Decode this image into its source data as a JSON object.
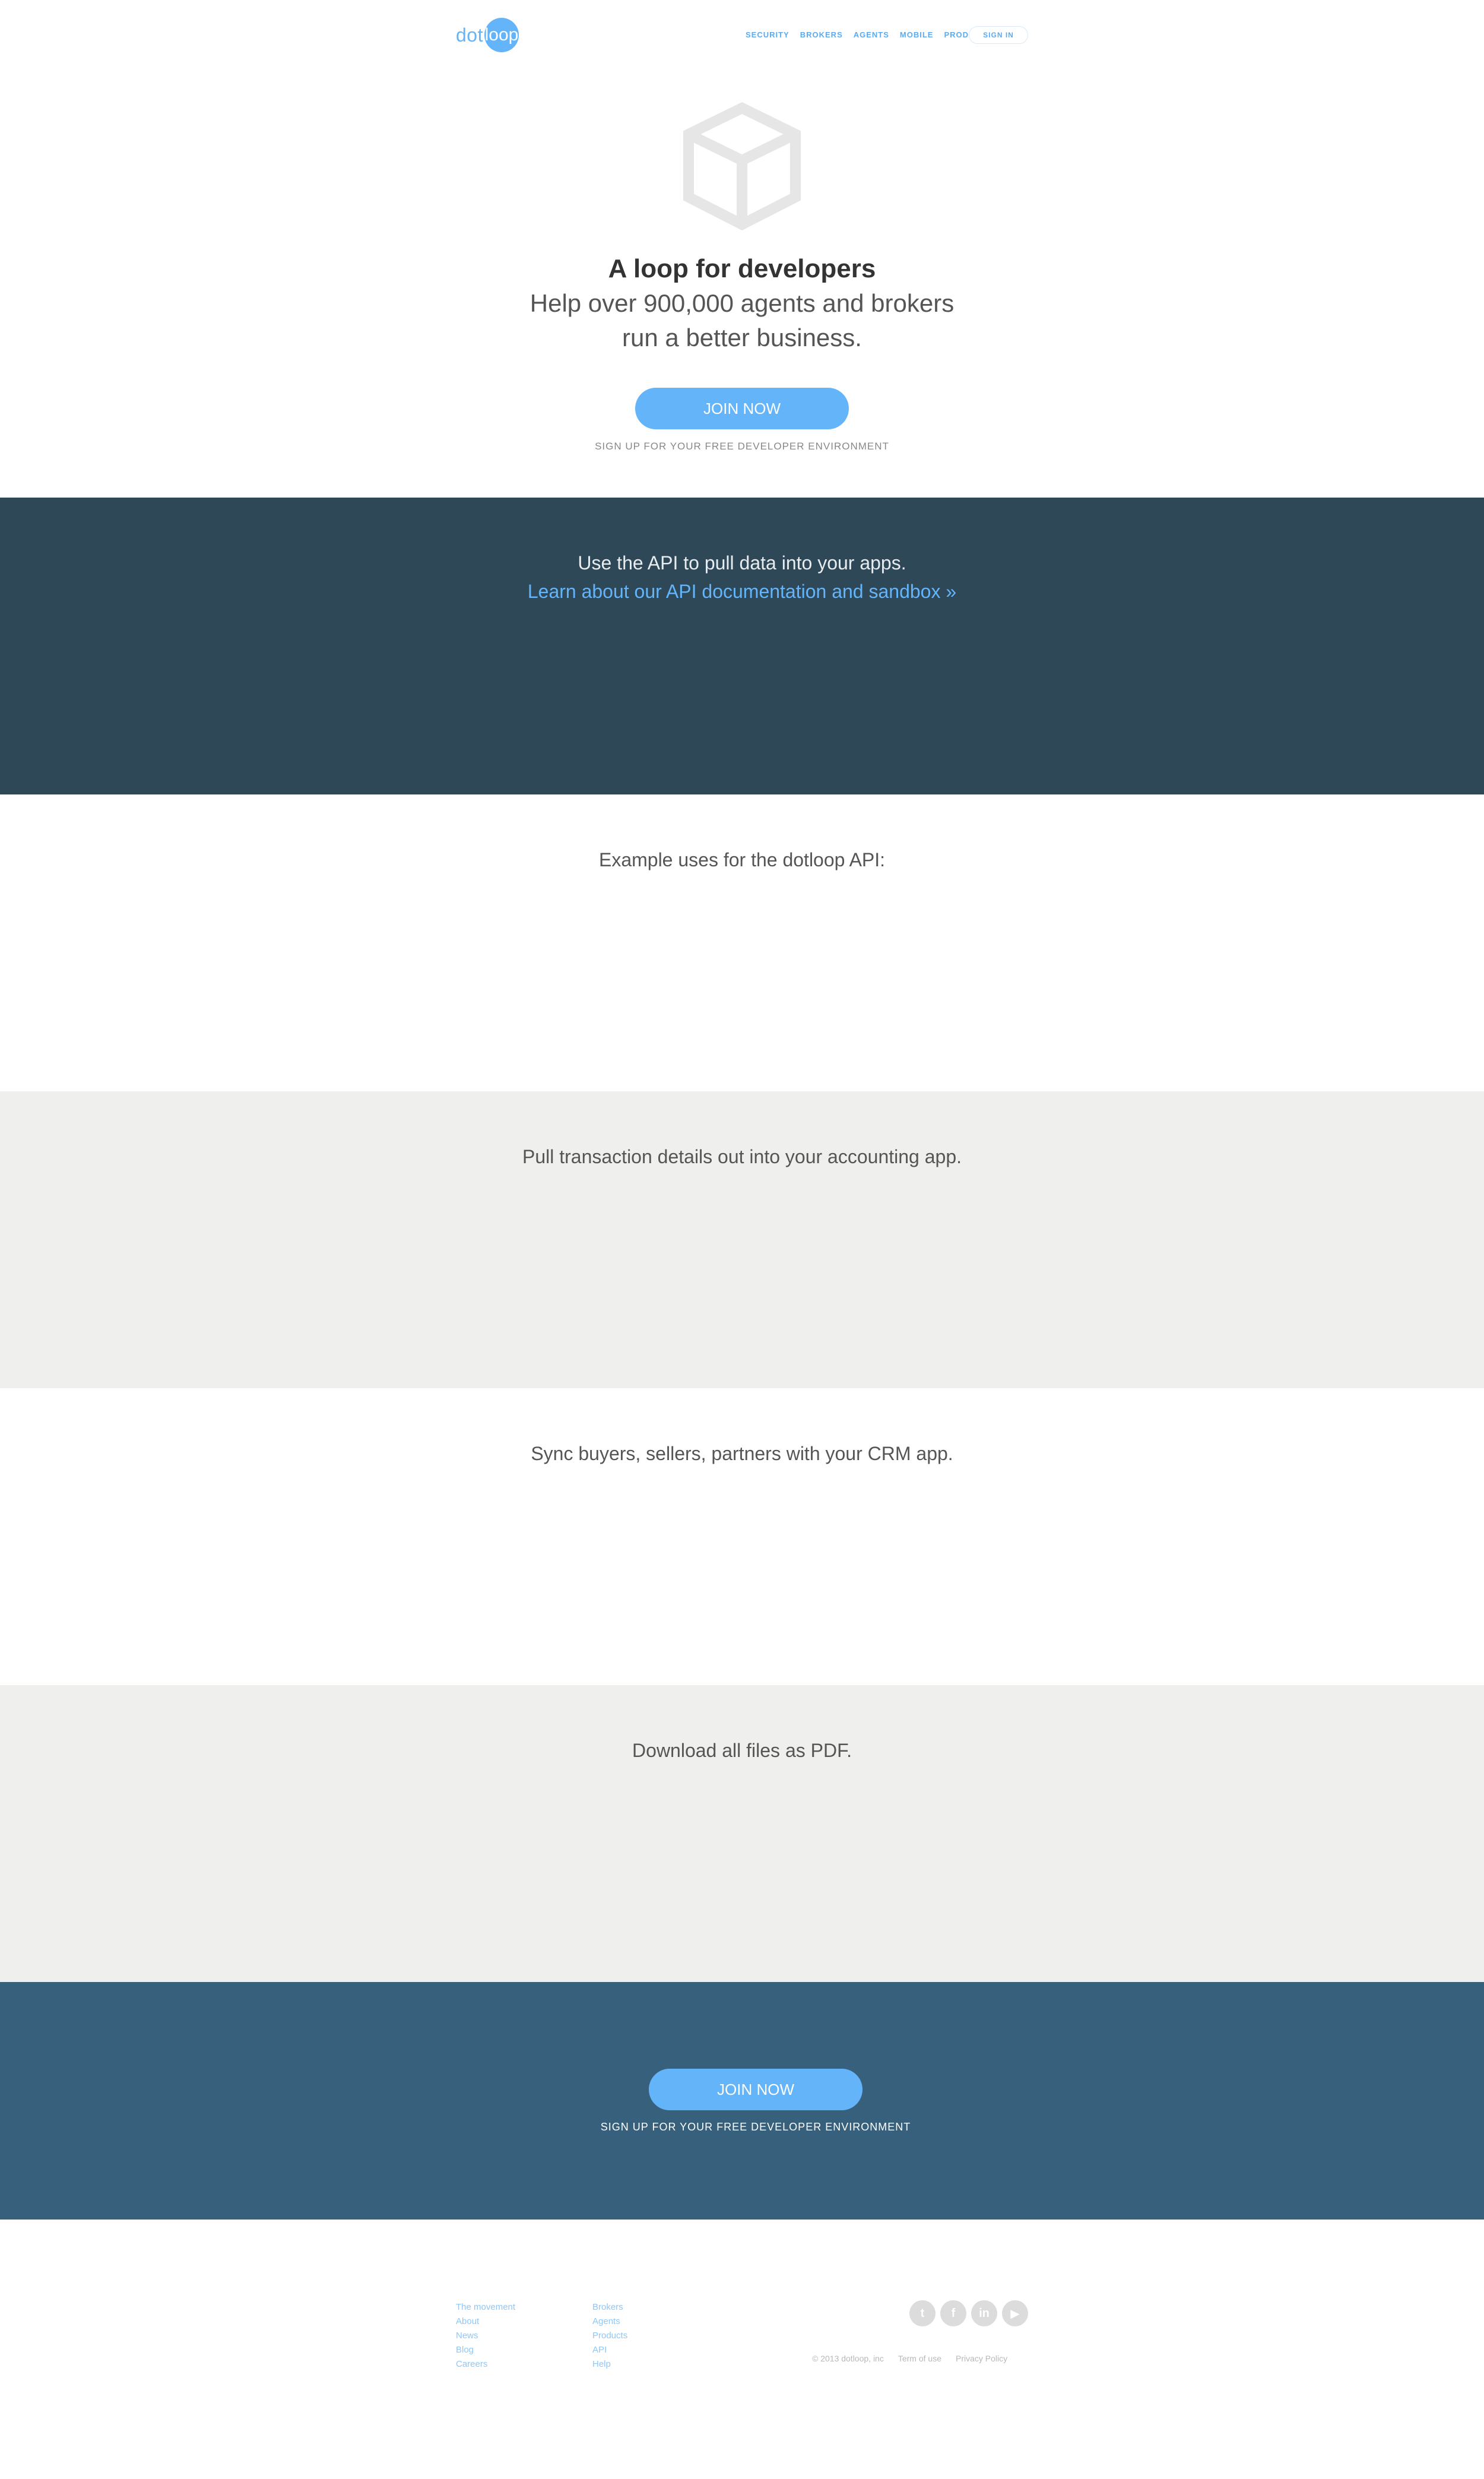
{
  "header": {
    "logo": {
      "dot": "dot",
      "loop": "loop"
    },
    "nav": [
      "SECURITY",
      "BROKERS",
      "AGENTS",
      "MOBILE",
      "PRODUCTS"
    ],
    "signin": "SIGN IN"
  },
  "hero": {
    "icon": "cube-icon",
    "title": "A loop for developers",
    "subtitle_line1": "Help over 900,000 agents and brokers",
    "subtitle_line2": "run a better business.",
    "button": "JOIN NOW",
    "note": "SIGN UP FOR YOUR FREE DEVELOPER ENVIRONMENT"
  },
  "api": {
    "line1": "Use the API to pull data into your apps.",
    "link": "Learn about our API documentation and sandbox »"
  },
  "examples": {
    "intro": "Example uses for the dotloop API:",
    "accounting": "Pull transaction details out into your accounting app.",
    "crm": "Sync buyers, sellers, partners with your CRM app.",
    "pdf": "Download all files as PDF."
  },
  "cta": {
    "button": "JOIN NOW",
    "note": "SIGN UP FOR YOUR FREE DEVELOPER ENVIRONMENT"
  },
  "footer": {
    "col1": [
      "The movement",
      "About",
      "News",
      "Blog",
      "Careers"
    ],
    "col2": [
      "Brokers",
      "Agents",
      "Products",
      "API",
      "Help"
    ],
    "social": [
      {
        "icon": "twitter-icon",
        "glyph": "t"
      },
      {
        "icon": "facebook-icon",
        "glyph": "f"
      },
      {
        "icon": "linkedin-icon",
        "glyph": "in"
      },
      {
        "icon": "youtube-icon",
        "glyph": "▶"
      }
    ],
    "copyright": "© 2013 dotloop, inc",
    "terms": "Term of use",
    "privacy": "Privacy Policy"
  },
  "colors": {
    "accent": "#64b4fa",
    "api_band": "#2f4858",
    "cta_band": "#37607d",
    "alt_band": "#efefed"
  }
}
